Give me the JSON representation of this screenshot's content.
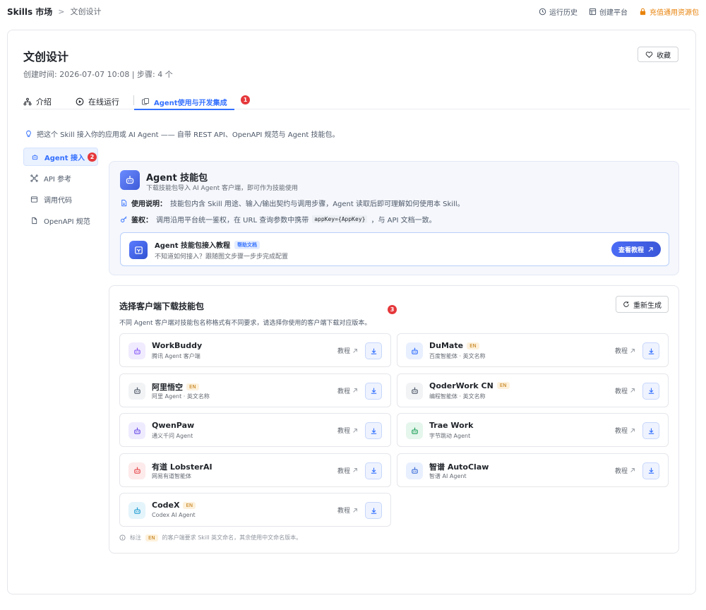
{
  "breadcrumb": {
    "root": "Skills 市场",
    "sep": ">",
    "current": "文创设计"
  },
  "top_actions": {
    "history": "运行历史",
    "create": "创建平台",
    "recharge": "充值通用资源包"
  },
  "page": {
    "title": "文创设计",
    "meta": "创建时间: 2026-07-07 10:08 | 步骤: 4 个",
    "favorite": "收藏"
  },
  "tabs": {
    "intro": "介绍",
    "run": "在线运行",
    "agent": "Agent使用与开发集成"
  },
  "badges": {
    "one": "1",
    "two": "2",
    "three": "3"
  },
  "intro_line": "把这个 Skill 接入你的应用或 AI Agent —— 自带 REST API、OpenAPI 规范与 Agent 技能包。",
  "sidenav": {
    "agent": "Agent 接入",
    "api": "API 参考",
    "code": "调用代码",
    "openapi": "OpenAPI 规范"
  },
  "package": {
    "title": "Agent 技能包",
    "subtitle": "下载技能包导入 AI Agent 客户端，即可作为技能使用",
    "usage_label": "使用说明：",
    "usage_text": "技能包内含 Skill 用途、输入/输出契约与调用步骤，Agent 读取后即可理解如何使用本 Skill。",
    "auth_label": "鉴权：",
    "auth_text_a": "调用沿用平台统一鉴权，在 URL 查询参数中携带",
    "auth_code": "appKey={AppKey}",
    "auth_text_b": "，与 API 文档一致。"
  },
  "tutorial": {
    "title": "Agent 技能包接入教程",
    "tag": "帮助文档",
    "subtitle": "不知道如何接入？跟随图文步骤一步步完成配置",
    "button": "查看教程"
  },
  "clients_panel": {
    "title": "选择客户端下载技能包",
    "regen": "重新生成",
    "desc": "不同 Agent 客户端对技能包名称格式有不同要求，请选择你使用的客户端下载对应版本。",
    "tutorial_label": "教程",
    "en_tag": "EN",
    "note_a": "标注",
    "note_b": "的客户端要求 Skill 英文命名，其余使用中文命名版本。"
  },
  "clients": [
    {
      "name": "WorkBuddy",
      "sub": "腾讯 Agent 客户端",
      "en": false,
      "color": "#8a5cf6",
      "bg": "#f1ebff"
    },
    {
      "name": "DuMate",
      "sub": "百度智能体 · 英文名称",
      "en": true,
      "color": "#3370ff",
      "bg": "#e8efff"
    },
    {
      "name": "阿里悟空",
      "sub": "阿里 Agent · 英文名称",
      "en": true,
      "color": "#4e5969",
      "bg": "#f2f3f5"
    },
    {
      "name": "QoderWork CN",
      "sub": "编程智能体 · 英文名称",
      "en": true,
      "color": "#4e5969",
      "bg": "#f2f3f5"
    },
    {
      "name": "QwenPaw",
      "sub": "通义千问 Agent",
      "en": false,
      "color": "#6b4ce6",
      "bg": "#efebff"
    },
    {
      "name": "Trae Work",
      "sub": "字节跳动 Agent",
      "en": false,
      "color": "#1fa15a",
      "bg": "#e5f6ec"
    },
    {
      "name": "有道 LobsterAI",
      "sub": "网易有道智能体",
      "en": false,
      "color": "#e5484d",
      "bg": "#fdeaea"
    },
    {
      "name": "智谱 AutoClaw",
      "sub": "智谱 AI Agent",
      "en": false,
      "color": "#3f6fd8",
      "bg": "#e8efff"
    },
    {
      "name": "CodeX",
      "sub": "Codex AI Agent",
      "en": true,
      "color": "#1f9bd1",
      "bg": "#e4f4fb"
    }
  ]
}
